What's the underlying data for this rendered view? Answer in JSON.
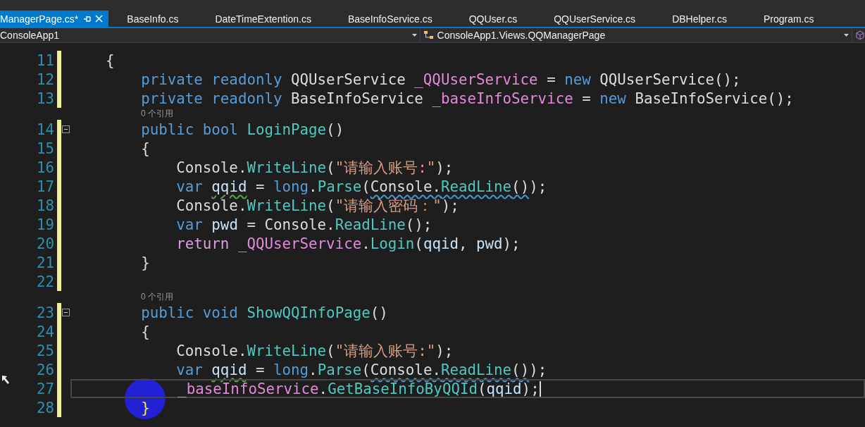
{
  "tabs": [
    {
      "label": "ManagerPage.cs*",
      "selected": true
    },
    {
      "label": "BaseInfo.cs",
      "selected": false
    },
    {
      "label": "DateTimeExtention.cs",
      "selected": false
    },
    {
      "label": "BaseInfoService.cs",
      "selected": false
    },
    {
      "label": "QQUser.cs",
      "selected": false
    },
    {
      "label": "QQUserService.cs",
      "selected": false
    },
    {
      "label": "DBHelper.cs",
      "selected": false
    },
    {
      "label": "Program.cs",
      "selected": false
    }
  ],
  "navigation_bar": {
    "project": "ConsoleApp1",
    "type": "ConsoleApp1.Views.QQManagerPage"
  },
  "editor": {
    "lines": [
      {
        "kind": "code",
        "number": "11",
        "changed": true,
        "foldable": false,
        "current": false,
        "tokens": [
          {
            "t": "    {",
            "kind": "plain"
          }
        ]
      },
      {
        "kind": "code",
        "number": "12",
        "changed": true,
        "foldable": false,
        "current": false,
        "tokens": [
          {
            "t": "        private readonly ",
            "kind": "keyword"
          },
          {
            "t": "QQUserService ",
            "kind": "plain"
          },
          {
            "t": "_QQUserService",
            "kind": "field"
          },
          {
            "t": " = ",
            "kind": "plain"
          },
          {
            "t": "new ",
            "kind": "keyword"
          },
          {
            "t": "QQUserService();",
            "kind": "plain"
          }
        ]
      },
      {
        "kind": "code",
        "number": "13",
        "changed": true,
        "foldable": false,
        "current": false,
        "tokens": [
          {
            "t": "        private readonly ",
            "kind": "keyword"
          },
          {
            "t": "BaseInfoService ",
            "kind": "plain"
          },
          {
            "t": "_baseInfoService",
            "kind": "field"
          },
          {
            "t": " = ",
            "kind": "plain"
          },
          {
            "t": "new ",
            "kind": "keyword"
          },
          {
            "t": "BaseInfoService();",
            "kind": "plain"
          }
        ]
      },
      {
        "kind": "codelens",
        "text": "0 个引用"
      },
      {
        "kind": "code",
        "number": "14",
        "changed": true,
        "foldable": true,
        "current": false,
        "tokens": [
          {
            "t": "        public bool ",
            "kind": "keyword"
          },
          {
            "t": "LoginPage",
            "kind": "method"
          },
          {
            "t": "()",
            "kind": "plain"
          }
        ]
      },
      {
        "kind": "code",
        "number": "15",
        "changed": true,
        "foldable": false,
        "current": false,
        "tokens": [
          {
            "t": "        {",
            "kind": "plain"
          }
        ]
      },
      {
        "kind": "code",
        "number": "16",
        "changed": true,
        "foldable": false,
        "current": false,
        "tokens": [
          {
            "t": "            Console.",
            "kind": "plain"
          },
          {
            "t": "WriteLine",
            "kind": "method"
          },
          {
            "t": "(",
            "kind": "plain"
          },
          {
            "t": "\"请输入账号:\"",
            "kind": "string"
          },
          {
            "t": ");",
            "kind": "plain"
          }
        ]
      },
      {
        "kind": "code",
        "number": "17",
        "changed": true,
        "foldable": false,
        "current": false,
        "tokens": [
          {
            "t": "            var ",
            "kind": "keyword"
          },
          {
            "t": "qqid",
            "kind": "local",
            "warning_squiggle": true
          },
          {
            "t": " = ",
            "kind": "plain"
          },
          {
            "t": "long",
            "kind": "keyword"
          },
          {
            "t": ".",
            "kind": "plain"
          },
          {
            "t": "Parse",
            "kind": "method"
          },
          {
            "t": "(",
            "kind": "plain"
          },
          {
            "t": "Console.",
            "kind": "plain",
            "info_squiggle": true
          },
          {
            "t": "ReadLine",
            "kind": "method",
            "info_squiggle": true
          },
          {
            "t": "()",
            "kind": "plain",
            "info_squiggle": true
          },
          {
            "t": ");",
            "kind": "plain"
          }
        ]
      },
      {
        "kind": "code",
        "number": "18",
        "changed": true,
        "foldable": false,
        "current": false,
        "tokens": [
          {
            "t": "            Console.",
            "kind": "plain"
          },
          {
            "t": "WriteLine",
            "kind": "method"
          },
          {
            "t": "(",
            "kind": "plain"
          },
          {
            "t": "\"请输入密码：\"",
            "kind": "string"
          },
          {
            "t": ");",
            "kind": "plain"
          }
        ]
      },
      {
        "kind": "code",
        "number": "19",
        "changed": true,
        "foldable": false,
        "current": false,
        "tokens": [
          {
            "t": "            var ",
            "kind": "keyword"
          },
          {
            "t": "pwd",
            "kind": "local"
          },
          {
            "t": " = Console.",
            "kind": "plain"
          },
          {
            "t": "ReadLine",
            "kind": "method"
          },
          {
            "t": "();",
            "kind": "plain"
          }
        ]
      },
      {
        "kind": "code",
        "number": "20",
        "changed": true,
        "foldable": false,
        "current": false,
        "tokens": [
          {
            "t": "            return ",
            "kind": "control"
          },
          {
            "t": "_QQUserService",
            "kind": "field"
          },
          {
            "t": ".",
            "kind": "plain"
          },
          {
            "t": "Login",
            "kind": "method"
          },
          {
            "t": "(",
            "kind": "plain"
          },
          {
            "t": "qqid",
            "kind": "local"
          },
          {
            "t": ", ",
            "kind": "plain"
          },
          {
            "t": "pwd",
            "kind": "local"
          },
          {
            "t": ");",
            "kind": "plain"
          }
        ]
      },
      {
        "kind": "code",
        "number": "21",
        "changed": true,
        "foldable": false,
        "current": false,
        "tokens": [
          {
            "t": "        }",
            "kind": "plain"
          }
        ]
      },
      {
        "kind": "code",
        "number": "22",
        "changed": true,
        "foldable": false,
        "current": false
      },
      {
        "kind": "codelens",
        "text": "0 个引用"
      },
      {
        "kind": "code",
        "number": "23",
        "changed": true,
        "foldable": true,
        "current": false,
        "tokens": [
          {
            "t": "        public void ",
            "kind": "keyword"
          },
          {
            "t": "ShowQQInfoPage",
            "kind": "method"
          },
          {
            "t": "()",
            "kind": "plain"
          }
        ]
      },
      {
        "kind": "code",
        "number": "24",
        "changed": true,
        "foldable": false,
        "current": false,
        "tokens": [
          {
            "t": "        {",
            "kind": "plain"
          }
        ]
      },
      {
        "kind": "code",
        "number": "25",
        "changed": true,
        "foldable": false,
        "current": false,
        "tokens": [
          {
            "t": "            Console.",
            "kind": "plain"
          },
          {
            "t": "WriteLine",
            "kind": "method"
          },
          {
            "t": "(",
            "kind": "plain"
          },
          {
            "t": "\"请输入账号:\"",
            "kind": "string"
          },
          {
            "t": ");",
            "kind": "plain"
          }
        ]
      },
      {
        "kind": "code",
        "number": "26",
        "changed": true,
        "foldable": false,
        "current": false,
        "tokens": [
          {
            "t": "            var ",
            "kind": "keyword"
          },
          {
            "t": "qqid",
            "kind": "local",
            "warning_squiggle": true
          },
          {
            "t": " = ",
            "kind": "plain"
          },
          {
            "t": "long",
            "kind": "keyword"
          },
          {
            "t": ".",
            "kind": "plain"
          },
          {
            "t": "Parse",
            "kind": "method"
          },
          {
            "t": "(",
            "kind": "plain"
          },
          {
            "t": "Console.",
            "kind": "plain",
            "info_squiggle": true
          },
          {
            "t": "ReadLine",
            "kind": "method",
            "info_squiggle": true
          },
          {
            "t": "()",
            "kind": "plain",
            "info_squiggle": true
          },
          {
            "t": ");",
            "kind": "plain"
          }
        ]
      },
      {
        "kind": "code",
        "number": "27",
        "changed": true,
        "foldable": false,
        "current": true,
        "tokens": [
          {
            "t": "            _baseInfoService",
            "kind": "field"
          },
          {
            "t": ".",
            "kind": "plain"
          },
          {
            "t": "GetBaseInfoByQQId",
            "kind": "method"
          },
          {
            "t": "(",
            "kind": "plain"
          },
          {
            "t": "qqid",
            "kind": "local"
          },
          {
            "t": ");",
            "kind": "plain"
          }
        ]
      },
      {
        "kind": "code",
        "number": "28",
        "changed": true,
        "foldable": false,
        "current": false,
        "tokens": [
          {
            "t": "        }",
            "kind": "brace_match"
          }
        ]
      }
    ]
  }
}
